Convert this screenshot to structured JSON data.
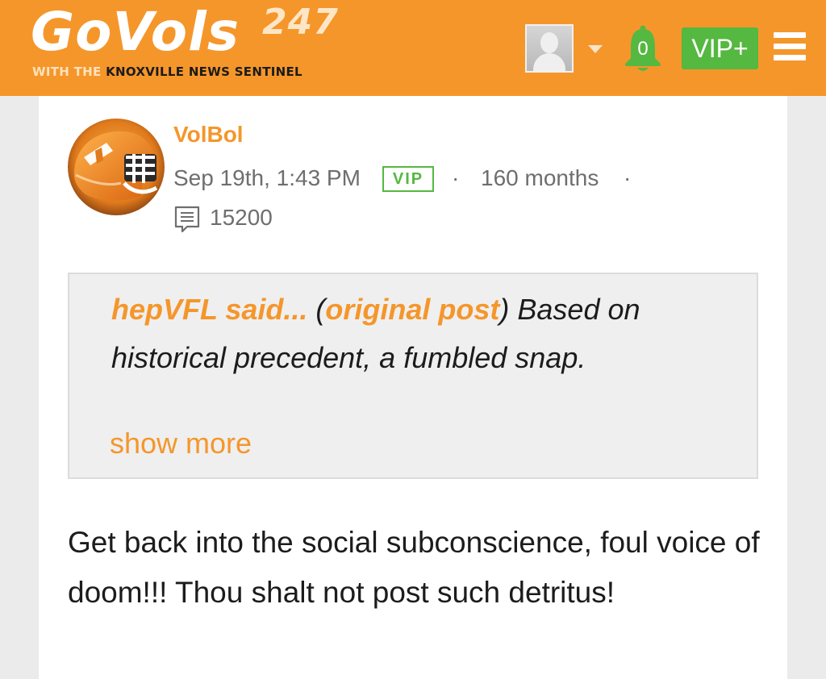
{
  "header": {
    "logo_go": "Go",
    "logo_vols": "Vols",
    "logo_number": "247",
    "logo_with": "WITH THE ",
    "logo_subtitle": "KNOXVILLE NEWS SENTINEL",
    "notification_count": "0",
    "vip_label": "VIP+",
    "colors": {
      "brand": "#f5962b",
      "vip": "#55b840"
    }
  },
  "post": {
    "username": "VolBol",
    "timestamp": "Sep 19th, 1:43 PM",
    "badge": "VIP",
    "separator": "·",
    "membership": "160 months",
    "post_count": "15200",
    "quote": {
      "author": "hepVFL said...",
      "open_paren": " (",
      "link": "original post",
      "close_paren": ")",
      "text": " Based on historical precedent, a fumbled snap.",
      "show_more": "show more"
    },
    "body": "Get back into the social subconscience, foul voice of doom!!! Thou shalt not post such detritus!"
  },
  "icons": [
    "user-avatar-icon",
    "chevron-down-icon",
    "bell-icon",
    "menu-icon",
    "comment-icon"
  ]
}
